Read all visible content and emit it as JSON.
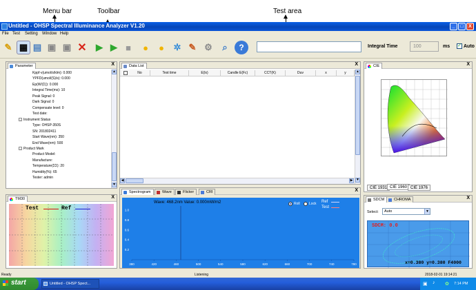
{
  "annotations": {
    "menu_bar": "Menu bar",
    "toolbar": "Toolbar",
    "test_area": "Test area"
  },
  "window": {
    "title": "Untitled - OHSP Spectral Illuminance Analyzer V1.20",
    "controls": [
      "_",
      "□",
      "X"
    ]
  },
  "menu": [
    "File",
    "Test",
    "Setting",
    "Window",
    "Help"
  ],
  "toolbar": {
    "integral_time_label": "Integral Time",
    "integral_time_value": "100",
    "unit": "ms",
    "auto_label": "Auto",
    "auto_checked": true,
    "search_value": ""
  },
  "parameter_panel": {
    "title": "Parameter",
    "close": "X",
    "lines": [
      "Kppf·v(umol/s/klm): 0.000",
      "YPFD(umol/(S)/s): 0.000",
      "Ep(W/(Σ)): 0.000",
      "Integral Time(ms): 10",
      "Peak Signal: 0",
      "Dark Signal: 0",
      "Compensate level: 0",
      "Test date:"
    ],
    "instrument_status": {
      "heading": "Instrument Status",
      "lines": [
        "Type: OHSP-350S",
        "SN: 201802411",
        "Start Wave(nm): 350",
        "End Wave(nm): 500"
      ]
    },
    "product_mark": {
      "heading": "Product Mark",
      "lines": [
        "Product Model:",
        "Manufacture:",
        "Temperature(ΣΣ): 20",
        "Humidity(%): 65",
        "Tester: admin"
      ]
    }
  },
  "tm30_panel": {
    "title": "TM30",
    "close": "X",
    "legend_test": "Test",
    "legend_ref": "Ref"
  },
  "data_list": {
    "title": "Data List",
    "close": "X",
    "columns": [
      "No",
      "Test time",
      "E(lx)",
      "Candle E(Fc)",
      "CCT(K)",
      "Duv",
      "x",
      "y"
    ]
  },
  "spectrogram": {
    "tabs": [
      "Spectrogram",
      "Wave",
      "Flicker",
      "CRI"
    ],
    "close": "X",
    "readout": "Wave: 468.2nm Value: 0.000mW/m2",
    "radio_roll": "Roll",
    "radio_lock": "Lock",
    "legend_ref": "Ref",
    "legend_test": "Test"
  },
  "chart_data": {
    "type": "line",
    "x_ticks": [
      "380",
      "420",
      "460",
      "500",
      "540",
      "580",
      "620",
      "660",
      "700",
      "740",
      "780"
    ],
    "y_ticks": [
      "0.2",
      "0.4",
      "0.6",
      "0.8",
      "1.0"
    ],
    "xlim": [
      380,
      780
    ],
    "ylim": [
      0,
      1.0
    ],
    "cursor_x": 468.2,
    "series": []
  },
  "cie_panel": {
    "title": "CIE",
    "close": "X",
    "tabs": [
      "CIE 1931",
      "CIE 1960",
      "CIE 1976"
    ]
  },
  "sdcm_panel": {
    "tabs": [
      "SDCM",
      "CHROMA"
    ],
    "close": "X",
    "select_label": "Select:",
    "select_value": "Auto",
    "sdcm_text": "SDCM: 0.0",
    "coords": "x=0.380 y=0.380 F4000"
  },
  "status": {
    "left": "Ready",
    "center": "Listening",
    "right": "2018-02-01 19:14:21"
  },
  "taskbar": {
    "start": "start",
    "task": "Untitled - OHSP Spect...",
    "clock": "7:14 PM"
  },
  "colors": {
    "plot_bg": "#1e7fe8",
    "sdcm_bg": "#4a9bea",
    "titlebar": "#0a55d8"
  }
}
